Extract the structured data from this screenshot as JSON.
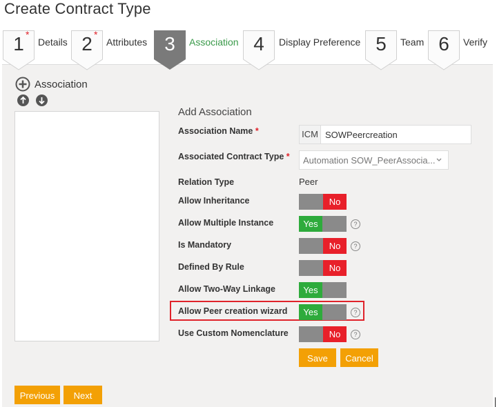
{
  "page": {
    "title": "Create Contract Type"
  },
  "wizard": {
    "steps": [
      {
        "number": "1",
        "label": "Details",
        "required": true,
        "active": false
      },
      {
        "number": "2",
        "label": "Attributes",
        "required": true,
        "active": false
      },
      {
        "number": "3",
        "label": "Association",
        "required": false,
        "active": true
      },
      {
        "number": "4",
        "label": "Display Preference",
        "required": false,
        "active": false
      },
      {
        "number": "5",
        "label": "Team",
        "required": false,
        "active": false
      },
      {
        "number": "6",
        "label": "Verify",
        "required": false,
        "active": false
      }
    ],
    "required_marker": "*"
  },
  "left": {
    "add_label": "Association",
    "icons": [
      "plus-circle-icon",
      "arrow-up-icon",
      "arrow-down-icon"
    ]
  },
  "form": {
    "title": "Add Association",
    "association_name": {
      "label": "Association Name",
      "prefix": "ICM",
      "value": "SOWPeercreation"
    },
    "associated_contract_type": {
      "label": "Associated Contract Type",
      "value": "Automation SOW_PeerAssocia..."
    },
    "relation_type": {
      "label": "Relation Type",
      "value": "Peer"
    },
    "toggles": [
      {
        "label": "Allow Inheritance",
        "state": "No",
        "help": false
      },
      {
        "label": "Allow Multiple Instance",
        "state": "Yes",
        "help": true
      },
      {
        "label": "Is Mandatory",
        "state": "No",
        "help": true
      },
      {
        "label": "Defined By Rule",
        "state": "No",
        "help": false
      },
      {
        "label": "Allow Two-Way Linkage",
        "state": "Yes",
        "help": false
      },
      {
        "label": "Allow Peer creation wizard",
        "state": "Yes",
        "help": true
      },
      {
        "label": "Use Custom Nomenclature",
        "state": "No",
        "help": true
      }
    ],
    "help_glyph": "?",
    "save_label": "Save",
    "cancel_label": "Cancel"
  },
  "footer": {
    "previous_label": "Previous",
    "next_label": "Next"
  },
  "colors": {
    "yes": "#2eab3c",
    "no": "#e8202a",
    "button": "#f3a005",
    "active_step": "#7a7a7a",
    "active_label": "#3a9a4a",
    "highlight": "#e0222a"
  }
}
